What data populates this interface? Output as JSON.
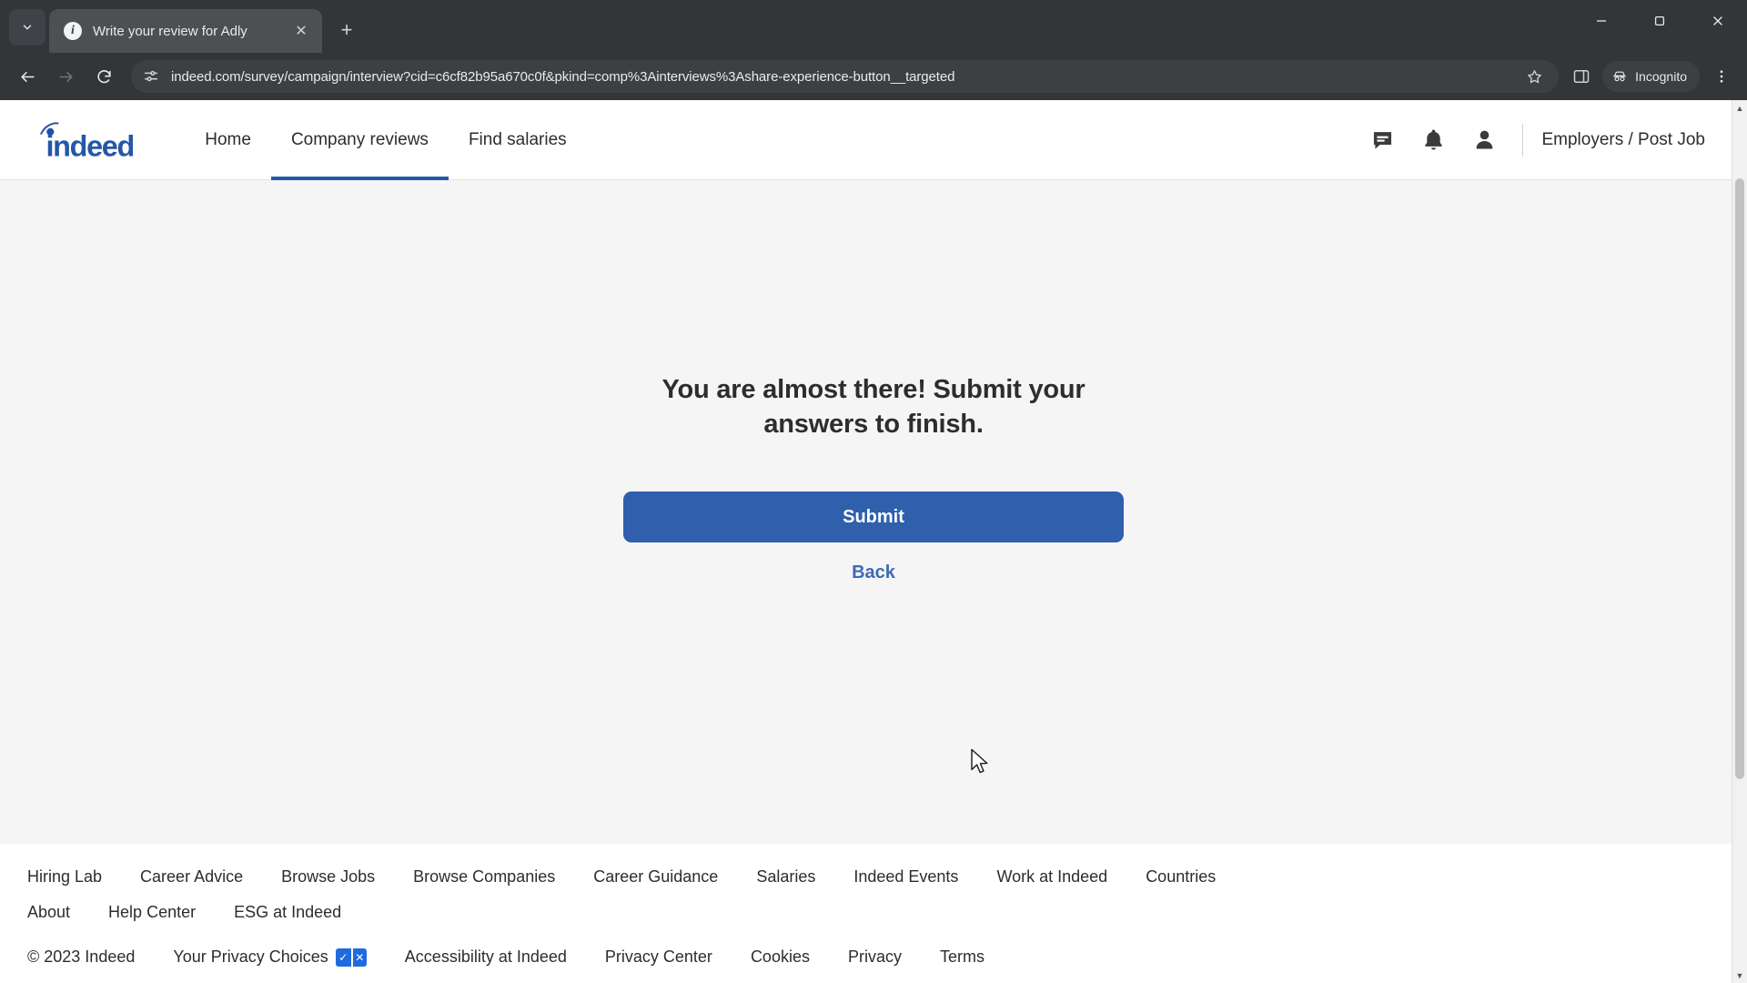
{
  "browser": {
    "tab": {
      "title": "Write your review for Adly",
      "favicon": "indeed-favicon-icon",
      "close_label": "✕"
    },
    "new_tab_label": "+",
    "window_controls": {
      "minimize": "minimize-icon",
      "maximize": "maximize-icon",
      "close": "close-icon"
    },
    "toolbar": {
      "back": "back-arrow-icon",
      "forward": "forward-arrow-icon",
      "reload": "reload-icon",
      "site_info": "site-settings-icon",
      "url": "indeed.com/survey/campaign/interview?cid=c6cf82b95a670c0f&pkind=comp%3Ainterviews%3Ashare-experience-button__targeted",
      "bookmark": "star-icon",
      "side_panel": "side-panel-icon",
      "incognito_label": "Incognito",
      "incognito_icon": "incognito-icon",
      "menu": "kebab-menu-icon"
    }
  },
  "site": {
    "logo_text": "indeed",
    "nav": [
      {
        "label": "Home",
        "active": false
      },
      {
        "label": "Company reviews",
        "active": true
      },
      {
        "label": "Find salaries",
        "active": false
      }
    ],
    "header_icons": [
      {
        "name": "messages-icon"
      },
      {
        "name": "notifications-bell-icon"
      },
      {
        "name": "account-person-icon"
      }
    ],
    "employers_link": "Employers / Post Job"
  },
  "survey": {
    "heading": "You are almost there! Submit your answers to finish.",
    "submit_label": "Submit",
    "back_label": "Back"
  },
  "footer": {
    "links": [
      "Hiring Lab",
      "Career Advice",
      "Browse Jobs",
      "Browse Companies",
      "Career Guidance",
      "Salaries",
      "Indeed Events",
      "Work at Indeed",
      "Countries",
      "About",
      "Help Center",
      "ESG at Indeed"
    ],
    "copyright": "© 2023 Indeed",
    "privacy_choices_label": "Your Privacy Choices",
    "privacy_badge": {
      "check": "✓",
      "cross": "✕"
    },
    "bottom_links": [
      "Accessibility at Indeed",
      "Privacy Center",
      "Cookies",
      "Privacy",
      "Terms"
    ]
  },
  "colors": {
    "indeed_blue": "#2557a7",
    "submit_blue": "#2f5fad",
    "back_blue": "#3f6ab4",
    "page_bg": "#f5f5f5",
    "chrome_bg": "#323639"
  }
}
